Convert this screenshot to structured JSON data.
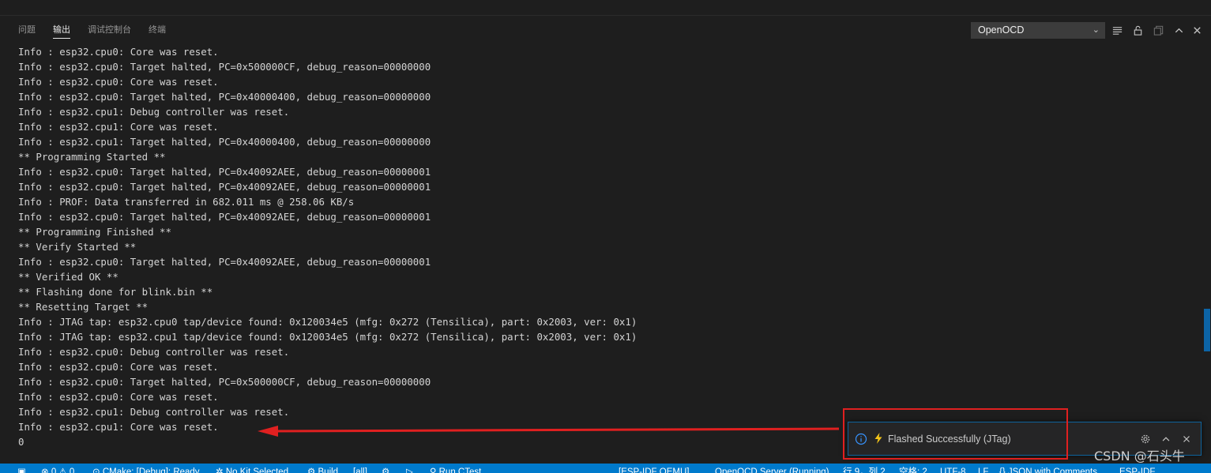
{
  "panel": {
    "tabs": [
      {
        "label": "问题",
        "active": false
      },
      {
        "label": "输出",
        "active": true
      },
      {
        "label": "调试控制台",
        "active": false
      },
      {
        "label": "终端",
        "active": false
      }
    ],
    "channel": "OpenOCD",
    "header_icons": [
      "list-filter-icon",
      "lock-icon",
      "copy-icon",
      "chevron-up-icon",
      "close-icon"
    ]
  },
  "output_lines": [
    "Info : esp32.cpu0: Core was reset.",
    "Info : esp32.cpu0: Target halted, PC=0x500000CF, debug_reason=00000000",
    "Info : esp32.cpu0: Core was reset.",
    "Info : esp32.cpu0: Target halted, PC=0x40000400, debug_reason=00000000",
    "Info : esp32.cpu1: Debug controller was reset.",
    "Info : esp32.cpu1: Core was reset.",
    "Info : esp32.cpu1: Target halted, PC=0x40000400, debug_reason=00000000",
    "** Programming Started **",
    "Info : esp32.cpu0: Target halted, PC=0x40092AEE, debug_reason=00000001",
    "Info : esp32.cpu0: Target halted, PC=0x40092AEE, debug_reason=00000001",
    "Info : PROF: Data transferred in 682.011 ms @ 258.06 KB/s",
    "Info : esp32.cpu0: Target halted, PC=0x40092AEE, debug_reason=00000001",
    "** Programming Finished **",
    "** Verify Started **",
    "Info : esp32.cpu0: Target halted, PC=0x40092AEE, debug_reason=00000001",
    "** Verified OK **",
    "** Flashing done for blink.bin **",
    "** Resetting Target **",
    "Info : JTAG tap: esp32.cpu0 tap/device found: 0x120034e5 (mfg: 0x272 (Tensilica), part: 0x2003, ver: 0x1)",
    "Info : JTAG tap: esp32.cpu1 tap/device found: 0x120034e5 (mfg: 0x272 (Tensilica), part: 0x2003, ver: 0x1)",
    "Info : esp32.cpu0: Debug controller was reset.",
    "Info : esp32.cpu0: Core was reset.",
    "Info : esp32.cpu0: Target halted, PC=0x500000CF, debug_reason=00000000",
    "Info : esp32.cpu0: Core was reset.",
    "Info : esp32.cpu1: Debug controller was reset.",
    "Info : esp32.cpu1: Core was reset.",
    "0"
  ],
  "notification": {
    "icon": "info-icon",
    "prefix_icon": "lightning-bolt-icon",
    "message": "Flashed Successfully (JTag)",
    "actions": [
      "gear-icon",
      "chevron-up-icon",
      "close-icon"
    ]
  },
  "watermark": "CSDN @石头牛",
  "status_bar": {
    "items": [
      "⊗ 0 ⚠ 0",
      "⊙ CMake: [Debug]: Ready",
      "✲ No Kit Selected",
      "⚙ Build",
      "[all]",
      "⚙",
      "▷",
      "⚲ Run CTest",
      "[ESP-IDF QEMU]",
      "OpenOCD Server (Running)",
      "行 9，列 2",
      "空格: 2",
      "UTF-8",
      "LF",
      "{} JSON with Comments",
      "ESP-IDF"
    ]
  },
  "colors": {
    "background": "#1e1e1e",
    "text": "#d4d4d4",
    "status_bar": "#007acc",
    "annotation_red": "#e02020",
    "info_blue": "#3794ff",
    "bolt_yellow": "#f5c518"
  }
}
